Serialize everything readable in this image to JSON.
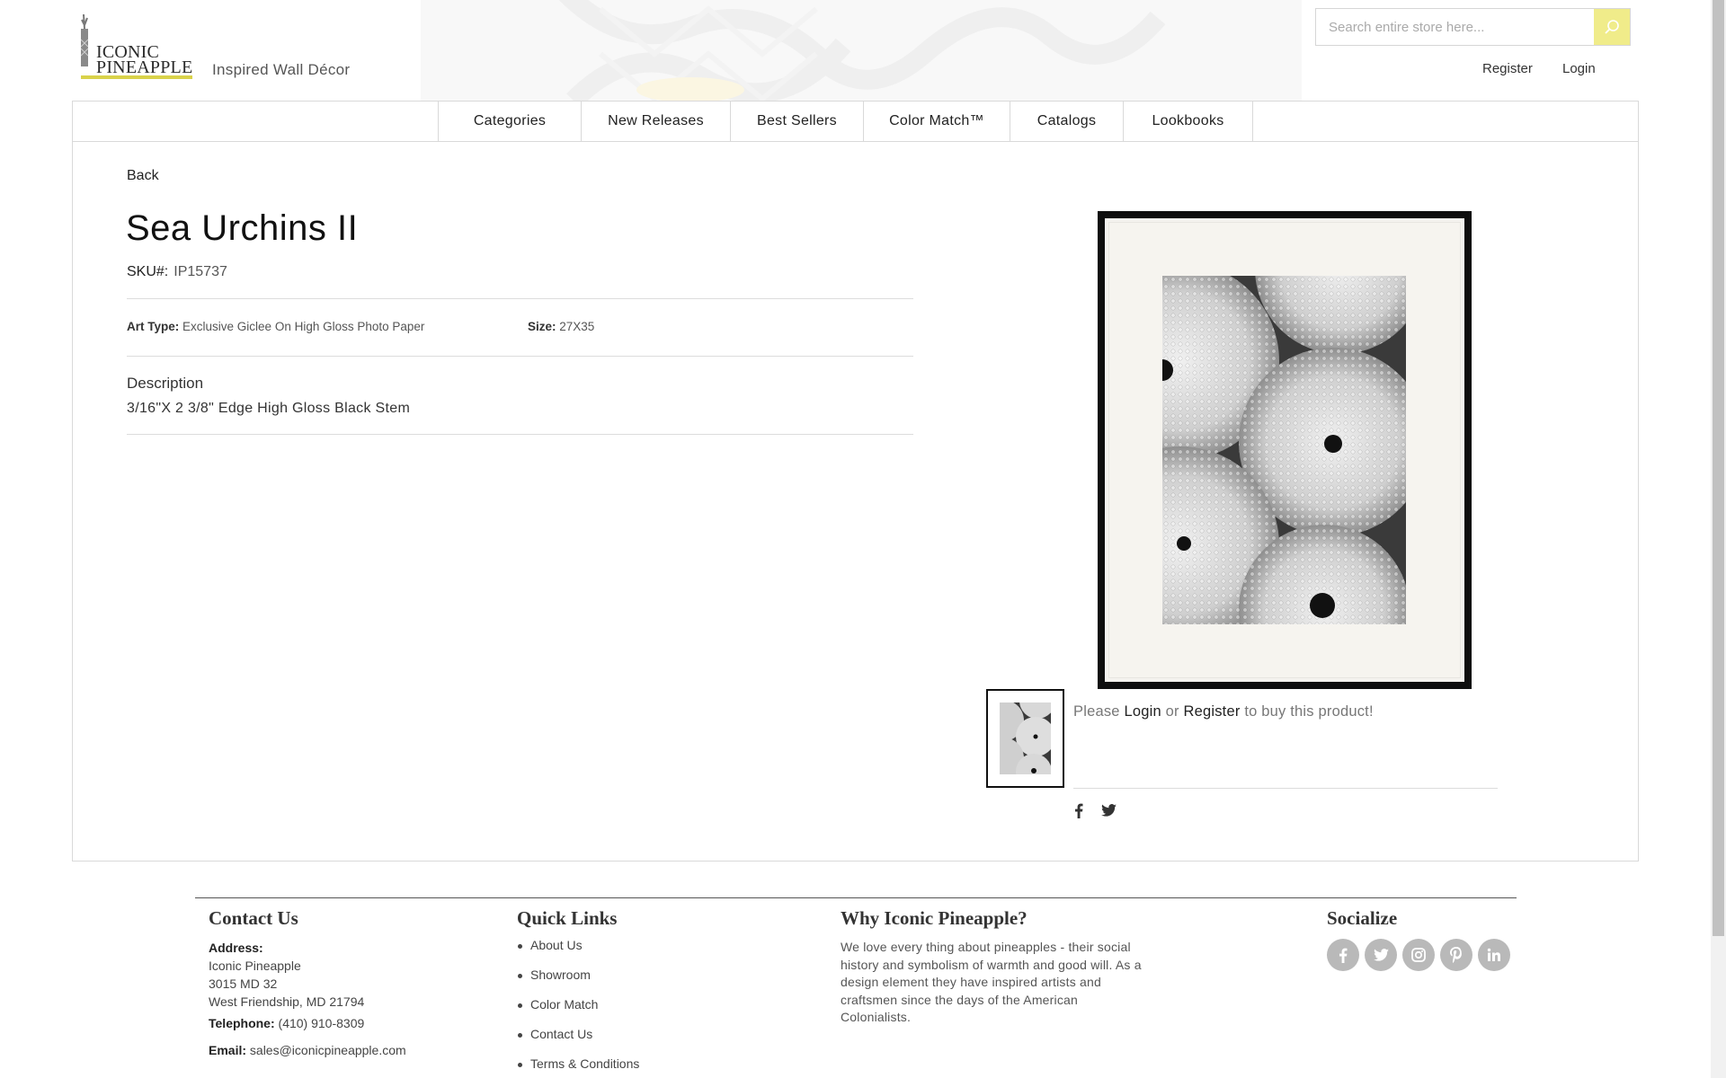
{
  "header": {
    "logo_line1": "ICONIC",
    "logo_line2": "PINEAPPLE",
    "tagline": "Inspired Wall Décor",
    "search_placeholder": "Search entire store here...",
    "register_label": "Register",
    "login_label": "Login",
    "accent_color": "#f0ec8a"
  },
  "nav": {
    "items": [
      {
        "label": "Categories"
      },
      {
        "label": "New Releases"
      },
      {
        "label": "Best Sellers"
      },
      {
        "label": "Color Match™"
      },
      {
        "label": "Catalogs"
      },
      {
        "label": "Lookbooks"
      }
    ]
  },
  "product": {
    "back_label": "Back",
    "title": "Sea Urchins II",
    "sku_label": "SKU#:",
    "sku_value": "IP15737",
    "art_type_label": "Art Type:",
    "art_type_value": "Exclusive Giclee On High Gloss Photo Paper",
    "size_label": "Size:",
    "size_value": "27X35",
    "description_heading": "Description",
    "description_text": "3/16\"X 2 3/8\" Edge High Gloss Black Stem",
    "buy_prefix": "Please",
    "buy_login": "Login",
    "buy_or": "or",
    "buy_register": "Register",
    "buy_suffix": "to buy this product!",
    "share_icons": [
      "facebook-icon",
      "twitter-icon"
    ]
  },
  "footer": {
    "contact_heading": "Contact Us",
    "address_label": "Address:",
    "address_lines": [
      "Iconic Pineapple",
      "3015 MD 32",
      "West Friendship, MD 21794"
    ],
    "telephone_label": "Telephone:",
    "telephone_value": "(410) 910-8309",
    "email_label": "Email:",
    "email_value": "sales@iconicpineapple.com",
    "quick_links_heading": "Quick Links",
    "quick_links": [
      "About Us",
      "Showroom",
      "Color Match",
      "Contact Us",
      "Terms & Conditions"
    ],
    "why_heading": "Why Iconic Pineapple?",
    "why_text": "We love every thing about pineapples - their social history and symbolism of warmth and good will. As a design element they have inspired artists and craftsmen since the days of the American Colonialists.",
    "socialize_heading": "Socialize",
    "social_icons": [
      "facebook-icon",
      "twitter-icon",
      "instagram-icon",
      "pinterest-icon",
      "linkedin-icon"
    ]
  }
}
